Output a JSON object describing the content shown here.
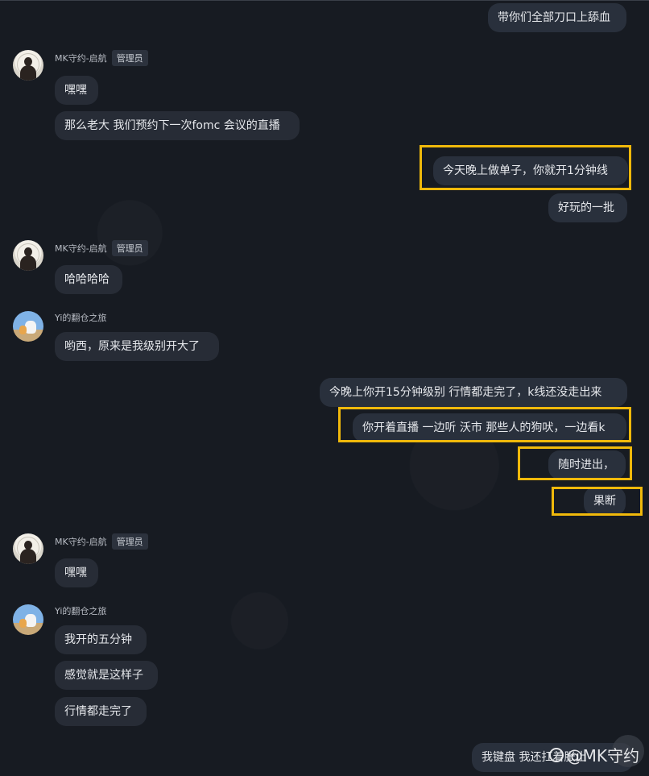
{
  "messages": {
    "m1": "带你们全部刀口上舔血",
    "m2": "嘿嘿",
    "m3": "那么老大 我们预约下一次fomc 会议的直播",
    "m4": "今天晚上做单子，你就开1分钟线",
    "m5": "好玩的一批",
    "m6": "哈哈哈哈",
    "m7": "哟西，原来是我级别开大了",
    "m8": "今晚上你开15分钟级别 行情都走完了，k线还没走出来",
    "m9": "你开着直播 一边听 沃市 那些人的狗吠，一边看k",
    "m10": "随时进出，",
    "m11": "果断",
    "m12": "嘿嘿",
    "m13": "我开的五分钟",
    "m14": "感觉就是这样子",
    "m15": "行情都走完了",
    "m16": "我键盘 我还扛着胀止"
  },
  "senders": {
    "mk": "MK守约-启航",
    "yi": "Yi的翻仓之旅",
    "admin_badge": "管理员"
  },
  "watermark": "@MK守约",
  "colors": {
    "highlight": "#f0b90b",
    "bubble": "#272c36",
    "background": "#171b22"
  }
}
